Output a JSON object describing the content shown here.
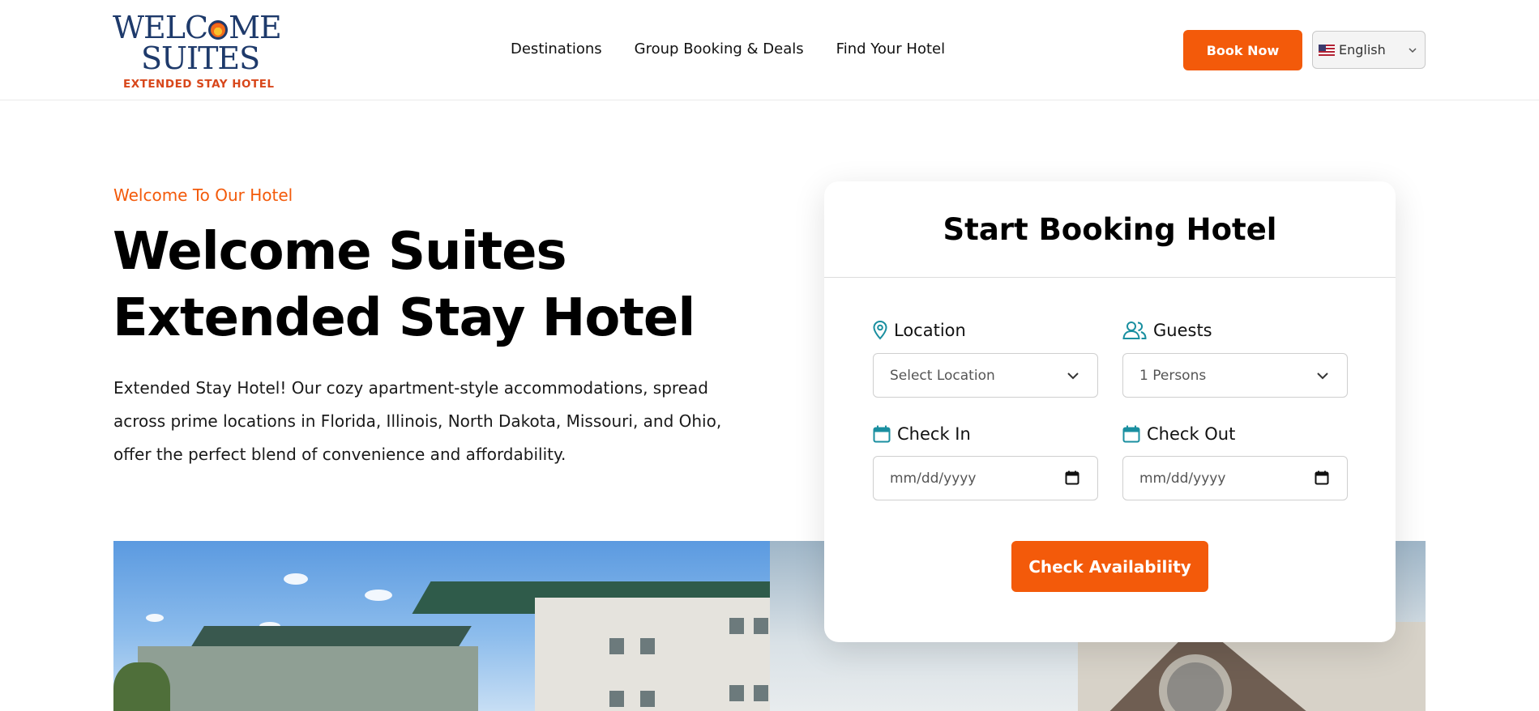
{
  "header": {
    "logo": {
      "line1": "WELCOME",
      "line2": "SUITES",
      "sub": "EXTENDED STAY HOTEL"
    },
    "nav": [
      "Destinations",
      "Group Booking & Deals",
      "Find Your Hotel"
    ],
    "book_now": "Book Now",
    "language": {
      "selected": "English",
      "flag_icon": "us-flag-icon"
    }
  },
  "hero": {
    "eyebrow": "Welcome To Our Hotel",
    "title_line1": "Welcome Suites",
    "title_line2": "Extended Stay Hotel",
    "description": "Extended Stay Hotel! Our cozy apartment-style accommodations, spread across prime locations in Florida, Illinois, North Dakota, Missouri, and Ohio, offer the perfect blend of convenience and affordability."
  },
  "booking": {
    "title": "Start Booking Hotel",
    "location": {
      "label": "Location",
      "placeholder": "Select Location",
      "icon": "map-pin-icon"
    },
    "guests": {
      "label": "Guests",
      "value": "1 Persons",
      "icon": "users-icon"
    },
    "check_in": {
      "label": "Check In",
      "placeholder": "mm/dd/yyyy",
      "icon": "calendar-icon"
    },
    "check_out": {
      "label": "Check Out",
      "placeholder": "mm/dd/yyyy",
      "icon": "calendar-icon"
    },
    "submit": "Check Availability"
  },
  "colors": {
    "accent": "#f35a0a",
    "icon_teal": "#1a8fa0",
    "logo_navy": "#1e3a6b"
  }
}
